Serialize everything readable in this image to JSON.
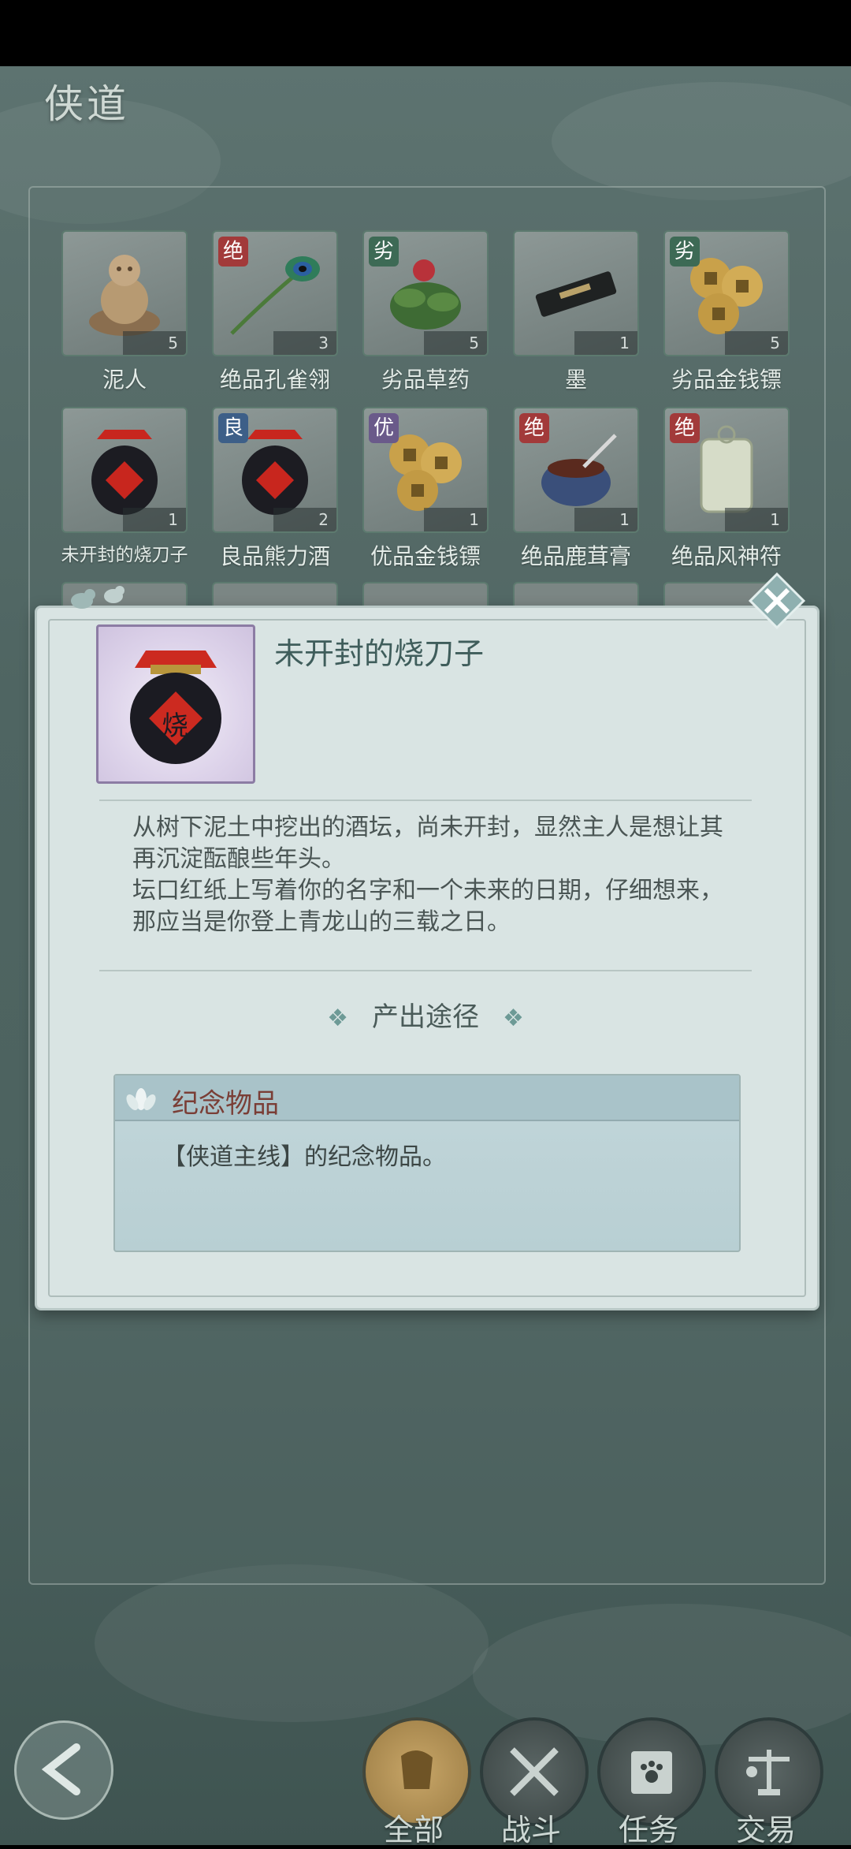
{
  "header": {
    "title": "侠道"
  },
  "items": [
    {
      "name": "泥人",
      "count": "5",
      "tag": "",
      "tag_color": "",
      "icon": "clay-figure-icon"
    },
    {
      "name": "绝品孔雀翎",
      "count": "3",
      "tag": "绝",
      "tag_color": "red",
      "icon": "peacock-feather-icon"
    },
    {
      "name": "劣品草药",
      "count": "5",
      "tag": "劣",
      "tag_color": "green",
      "icon": "herb-icon"
    },
    {
      "name": "墨",
      "count": "1",
      "tag": "",
      "tag_color": "",
      "icon": "ink-stick-icon"
    },
    {
      "name": "劣品金钱镖",
      "count": "5",
      "tag": "劣",
      "tag_color": "green",
      "icon": "coin-dart-icon"
    },
    {
      "name": "未开封的烧刀子",
      "count": "1",
      "tag": "",
      "tag_color": "",
      "icon": "wine-jar-icon"
    },
    {
      "name": "良品熊力酒",
      "count": "2",
      "tag": "良",
      "tag_color": "blue",
      "icon": "wine-jar-icon"
    },
    {
      "name": "优品金钱镖",
      "count": "1",
      "tag": "优",
      "tag_color": "purple",
      "icon": "coin-dart-icon"
    },
    {
      "name": "绝品鹿茸膏",
      "count": "1",
      "tag": "绝",
      "tag_color": "red",
      "icon": "ointment-bowl-icon"
    },
    {
      "name": "绝品风神符",
      "count": "1",
      "tag": "绝",
      "tag_color": "red",
      "icon": "talisman-icon"
    }
  ],
  "detail": {
    "title": "未开封的烧刀子",
    "jar_char": "烧",
    "description": [
      "从树下泥土中挖出的酒坛，尚未开封，显然主人是想让其再沉淀酝酿些年头。",
      "坛口红纸上写着你的名字和一个未来的日期，仔细想来，那应当是你登上青龙山的三载之日。"
    ],
    "source_heading": "产出途径",
    "source_label": "纪念物品",
    "source_text": "【侠道主线】的纪念物品。"
  },
  "nav": {
    "tabs": [
      {
        "label": "全部",
        "icon": "all-items-icon",
        "active": true
      },
      {
        "label": "战斗",
        "icon": "crossed-swords-icon",
        "active": false
      },
      {
        "label": "任务",
        "icon": "paw-book-icon",
        "active": false
      },
      {
        "label": "交易",
        "icon": "scale-icon",
        "active": false
      }
    ]
  },
  "colors": {
    "tag_red": "#a23a3a",
    "tag_green": "#3d6a55",
    "tag_purple": "#6a5a8a",
    "tag_blue": "#3d5f88",
    "accent_gold": "#c8a668",
    "modal_bg": "#d9e4e3"
  }
}
